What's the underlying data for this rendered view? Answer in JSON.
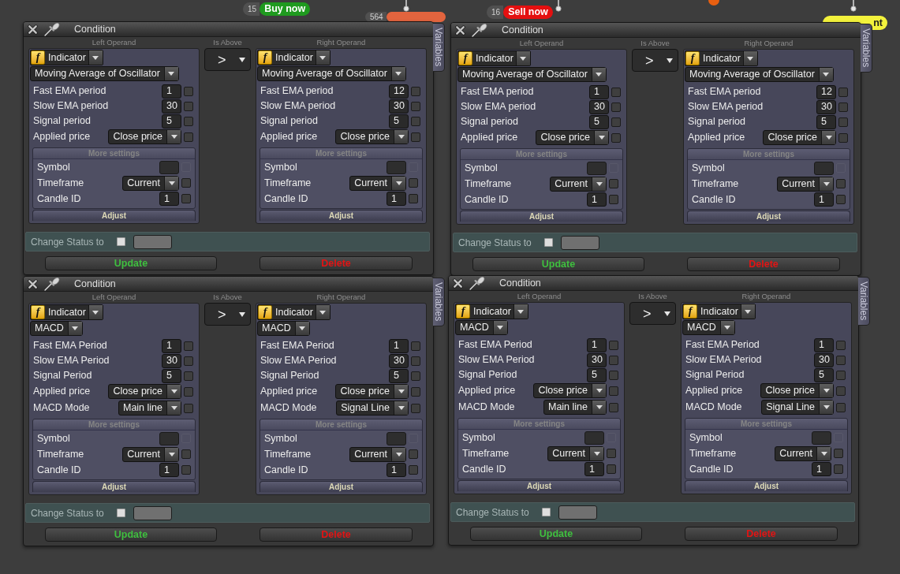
{
  "canvas_nodes": [
    {
      "kind": "pill",
      "number": "15",
      "label": "Buy now",
      "color": "#1f9a1f"
    },
    {
      "kind": "pill",
      "number": "564",
      "color": "#e2643e"
    },
    {
      "kind": "pill",
      "number": "16",
      "label": "Sell now",
      "color": "#e41010"
    },
    {
      "kind": "dot",
      "color": "#e85f10"
    },
    {
      "kind": "pill",
      "label": "nt",
      "color": "#f3f23c"
    }
  ],
  "conditions": [
    {
      "title": "Condition",
      "side_tab": "Variables",
      "column_headers": [
        "Left Operand",
        "Is Above",
        "Right Operand"
      ],
      "left_operand": {
        "icon": "f",
        "source": "Indicator",
        "indicator": "Moving Average of Oscillator",
        "params": [
          {
            "kind": "number",
            "label": "Fast EMA period",
            "value": "1",
            "checked": false
          },
          {
            "kind": "number",
            "label": "Slow EMA period",
            "value": "30",
            "checked": false
          },
          {
            "kind": "number",
            "label": "Signal period",
            "value": "5",
            "checked": false
          },
          {
            "kind": "select",
            "label": "Applied price",
            "value": "Close price",
            "checked": false
          }
        ],
        "more_settings": {
          "title": "More settings",
          "params": [
            {
              "kind": "text",
              "label": "Symbol",
              "checked": false,
              "disabled": true
            },
            {
              "kind": "select",
              "label": "Timeframe",
              "value": "Current",
              "checked": false,
              "disabled": false
            },
            {
              "kind": "number",
              "label": "Candle ID",
              "value": "1",
              "checked": false,
              "disabled": false
            }
          ]
        },
        "adjust": "Adjust"
      },
      "operator": {
        "symbol": ">"
      },
      "right_operand": {
        "icon": "f",
        "source": "Indicator",
        "indicator": "Moving Average of Oscillator",
        "params": [
          {
            "kind": "number",
            "label": "Fast EMA period",
            "value": "12",
            "checked": false
          },
          {
            "kind": "number",
            "label": "Slow EMA period",
            "value": "30",
            "checked": false
          },
          {
            "kind": "number",
            "label": "Signal period",
            "value": "5",
            "checked": false
          },
          {
            "kind": "select",
            "label": "Applied price",
            "value": "Close price",
            "checked": false
          }
        ],
        "more_settings": {
          "title": "More settings",
          "params": [
            {
              "kind": "text",
              "label": "Symbol",
              "checked": false,
              "disabled": true
            },
            {
              "kind": "select",
              "label": "Timeframe",
              "value": "Current",
              "checked": false,
              "disabled": false
            },
            {
              "kind": "number",
              "label": "Candle ID",
              "value": "1",
              "checked": false,
              "disabled": false
            }
          ]
        },
        "adjust": "Adjust"
      },
      "change_status": {
        "label": "Change Status to",
        "checked": false
      },
      "buttons": [
        {
          "kind": "update",
          "label": "Update"
        },
        {
          "kind": "delete",
          "label": "Delete"
        }
      ]
    },
    {
      "title": "Condition",
      "side_tab": "Variables",
      "column_headers": [
        "Left Operand",
        "Is Above",
        "Right Operand"
      ],
      "left_operand": {
        "icon": "f",
        "source": "Indicator",
        "indicator": "Moving Average of Oscillator",
        "params": [
          {
            "kind": "number",
            "label": "Fast EMA period",
            "value": "1",
            "checked": false
          },
          {
            "kind": "number",
            "label": "Slow EMA period",
            "value": "30",
            "checked": false
          },
          {
            "kind": "number",
            "label": "Signal period",
            "value": "5",
            "checked": false
          },
          {
            "kind": "select",
            "label": "Applied price",
            "value": "Close price",
            "checked": false
          }
        ],
        "more_settings": {
          "title": "More settings",
          "params": [
            {
              "kind": "text",
              "label": "Symbol",
              "checked": false,
              "disabled": true
            },
            {
              "kind": "select",
              "label": "Timeframe",
              "value": "Current",
              "checked": false,
              "disabled": false
            },
            {
              "kind": "number",
              "label": "Candle ID",
              "value": "1",
              "checked": false,
              "disabled": false
            }
          ]
        },
        "adjust": "Adjust"
      },
      "operator": {
        "symbol": ">"
      },
      "right_operand": {
        "icon": "f",
        "source": "Indicator",
        "indicator": "Moving Average of Oscillator",
        "params": [
          {
            "kind": "number",
            "label": "Fast EMA period",
            "value": "12",
            "checked": false
          },
          {
            "kind": "number",
            "label": "Slow EMA period",
            "value": "30",
            "checked": false
          },
          {
            "kind": "number",
            "label": "Signal period",
            "value": "5",
            "checked": false
          },
          {
            "kind": "select",
            "label": "Applied price",
            "value": "Close price",
            "checked": false
          }
        ],
        "more_settings": {
          "title": "More settings",
          "params": [
            {
              "kind": "text",
              "label": "Symbol",
              "checked": false,
              "disabled": true
            },
            {
              "kind": "select",
              "label": "Timeframe",
              "value": "Current",
              "checked": false,
              "disabled": false
            },
            {
              "kind": "number",
              "label": "Candle ID",
              "value": "1",
              "checked": false,
              "disabled": false
            }
          ]
        },
        "adjust": "Adjust"
      },
      "change_status": {
        "label": "Change Status to",
        "checked": false
      },
      "buttons": [
        {
          "kind": "update",
          "label": "Update"
        },
        {
          "kind": "delete",
          "label": "Delete"
        }
      ]
    },
    {
      "title": "Condition",
      "side_tab": "Variables",
      "column_headers": [
        "Left Operand",
        "Is Above",
        "Right Operand"
      ],
      "left_operand": {
        "icon": "f",
        "source": "Indicator",
        "indicator": "MACD",
        "params": [
          {
            "kind": "number",
            "label": "Fast EMA Period",
            "value": "1",
            "checked": false
          },
          {
            "kind": "number",
            "label": "Slow EMA Period",
            "value": "30",
            "checked": false
          },
          {
            "kind": "number",
            "label": "Signal Period",
            "value": "5",
            "checked": false
          },
          {
            "kind": "select",
            "label": "Applied price",
            "value": "Close price",
            "checked": false
          },
          {
            "kind": "select",
            "label": "MACD Mode",
            "value": "Main line",
            "checked": false
          }
        ],
        "more_settings": {
          "title": "More settings",
          "params": [
            {
              "kind": "text",
              "label": "Symbol",
              "checked": false,
              "disabled": true
            },
            {
              "kind": "select",
              "label": "Timeframe",
              "value": "Current",
              "checked": false,
              "disabled": false
            },
            {
              "kind": "number",
              "label": "Candle ID",
              "value": "1",
              "checked": false,
              "disabled": false
            }
          ]
        },
        "adjust": "Adjust"
      },
      "operator": {
        "symbol": ">"
      },
      "right_operand": {
        "icon": "f",
        "source": "Indicator",
        "indicator": "MACD",
        "params": [
          {
            "kind": "number",
            "label": "Fast EMA Period",
            "value": "1",
            "checked": false
          },
          {
            "kind": "number",
            "label": "Slow EMA Period",
            "value": "30",
            "checked": false
          },
          {
            "kind": "number",
            "label": "Signal Period",
            "value": "5",
            "checked": false
          },
          {
            "kind": "select",
            "label": "Applied price",
            "value": "Close price",
            "checked": false
          },
          {
            "kind": "select",
            "label": "MACD Mode",
            "value": "Signal Line",
            "checked": false
          }
        ],
        "more_settings": {
          "title": "More settings",
          "params": [
            {
              "kind": "text",
              "label": "Symbol",
              "checked": false,
              "disabled": true
            },
            {
              "kind": "select",
              "label": "Timeframe",
              "value": "Current",
              "checked": false,
              "disabled": false
            },
            {
              "kind": "number",
              "label": "Candle ID",
              "value": "1",
              "checked": false,
              "disabled": false
            }
          ]
        },
        "adjust": "Adjust"
      },
      "change_status": {
        "label": "Change Status to",
        "checked": false
      },
      "buttons": [
        {
          "kind": "update",
          "label": "Update"
        },
        {
          "kind": "delete",
          "label": "Delete"
        }
      ]
    },
    {
      "title": "Condition",
      "side_tab": "Variables",
      "column_headers": [
        "Left Operand",
        "Is Above",
        "Right Operand"
      ],
      "left_operand": {
        "icon": "f",
        "source": "Indicator",
        "indicator": "MACD",
        "params": [
          {
            "kind": "number",
            "label": "Fast EMA Period",
            "value": "1",
            "checked": false
          },
          {
            "kind": "number",
            "label": "Slow EMA Period",
            "value": "30",
            "checked": false
          },
          {
            "kind": "number",
            "label": "Signal Period",
            "value": "5",
            "checked": false
          },
          {
            "kind": "select",
            "label": "Applied price",
            "value": "Close price",
            "checked": false
          },
          {
            "kind": "select",
            "label": "MACD Mode",
            "value": "Main line",
            "checked": false
          }
        ],
        "more_settings": {
          "title": "More settings",
          "params": [
            {
              "kind": "text",
              "label": "Symbol",
              "checked": false,
              "disabled": true
            },
            {
              "kind": "select",
              "label": "Timeframe",
              "value": "Current",
              "checked": false,
              "disabled": false
            },
            {
              "kind": "number",
              "label": "Candle ID",
              "value": "1",
              "checked": false,
              "disabled": false
            }
          ]
        },
        "adjust": "Adjust"
      },
      "operator": {
        "symbol": ">"
      },
      "right_operand": {
        "icon": "f",
        "source": "Indicator",
        "indicator": "MACD",
        "params": [
          {
            "kind": "number",
            "label": "Fast EMA Period",
            "value": "1",
            "checked": false
          },
          {
            "kind": "number",
            "label": "Slow EMA Period",
            "value": "30",
            "checked": false
          },
          {
            "kind": "number",
            "label": "Signal Period",
            "value": "5",
            "checked": false
          },
          {
            "kind": "select",
            "label": "Applied price",
            "value": "Close price",
            "checked": false
          },
          {
            "kind": "select",
            "label": "MACD Mode",
            "value": "Signal Line",
            "checked": false
          }
        ],
        "more_settings": {
          "title": "More settings",
          "params": [
            {
              "kind": "text",
              "label": "Symbol",
              "checked": false,
              "disabled": true
            },
            {
              "kind": "select",
              "label": "Timeframe",
              "value": "Current",
              "checked": false,
              "disabled": false
            },
            {
              "kind": "number",
              "label": "Candle ID",
              "value": "1",
              "checked": false,
              "disabled": false
            }
          ]
        },
        "adjust": "Adjust"
      },
      "change_status": {
        "label": "Change Status to",
        "checked": false
      },
      "buttons": [
        {
          "kind": "update",
          "label": "Update"
        },
        {
          "kind": "delete",
          "label": "Delete"
        }
      ]
    }
  ]
}
